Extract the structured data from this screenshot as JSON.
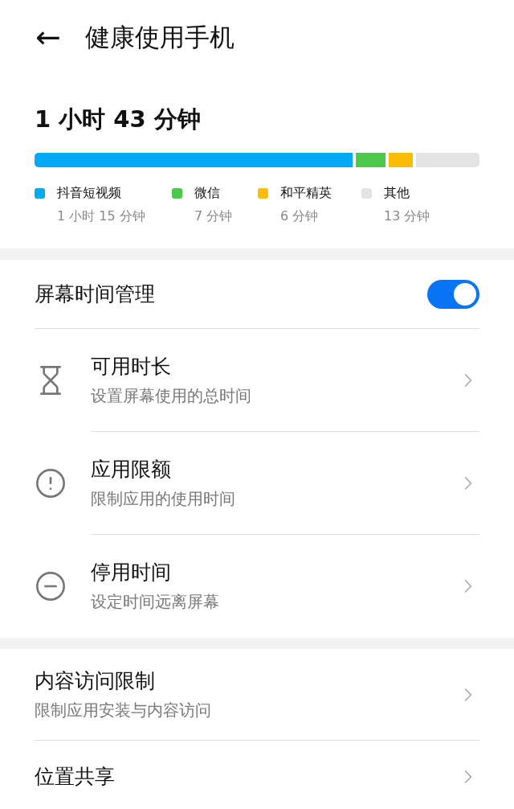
{
  "header": {
    "back": "←",
    "title": "健康使用手机"
  },
  "usage": {
    "total": "1 小时 43 分钟",
    "apps": [
      {
        "name": "抖音短视频",
        "time": "1 小时 15 分钟",
        "color": "#03a9f4"
      },
      {
        "name": "微信",
        "time": "7 分钟",
        "color": "#4cc84c"
      },
      {
        "name": "和平精英",
        "time": "6 分钟",
        "color": "#fbbc05"
      },
      {
        "name": "其他",
        "time": "13 分钟",
        "color": "#e3e3e3"
      }
    ]
  },
  "screen_time": {
    "label": "屏幕时间管理",
    "on": true,
    "items": [
      {
        "kind": "hourglass",
        "title": "可用时长",
        "subtitle": "设置屏幕使用的总时间"
      },
      {
        "kind": "alert",
        "title": "应用限额",
        "subtitle": "限制应用的使用时间"
      },
      {
        "kind": "minus",
        "title": "停用时间",
        "subtitle": "设定时间远离屏幕"
      }
    ]
  },
  "more_items": [
    {
      "title": "内容访问限制",
      "subtitle": "限制应用安装与内容访问"
    },
    {
      "title": "位置共享"
    }
  ]
}
